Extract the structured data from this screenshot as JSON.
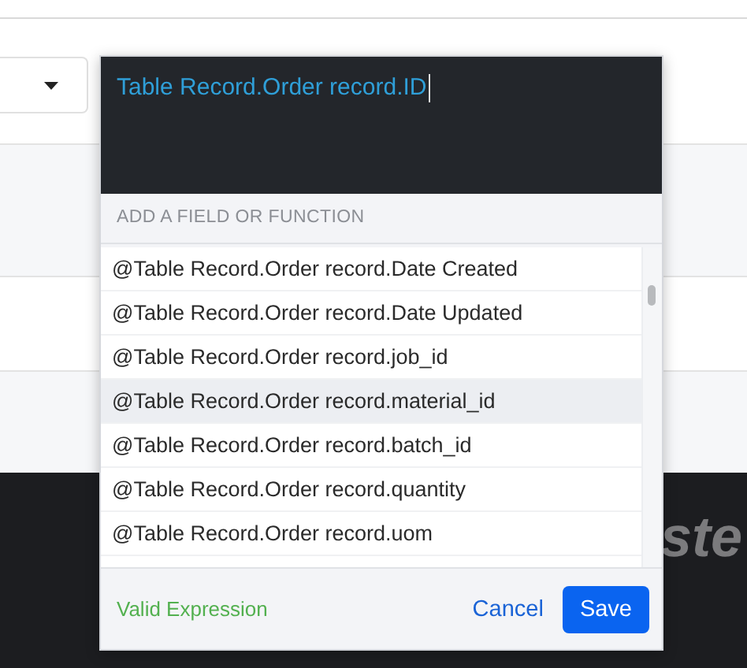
{
  "background": {
    "banner_texts": [
      {
        "text": "ste",
        "kind": "upper"
      }
    ]
  },
  "expression_editor": {
    "value": "Table Record.Order record.ID",
    "section_label": "ADD A FIELD OR FUNCTION",
    "suggestions": [
      {
        "label": "@Table Record.Order record.Date Created",
        "selected": false
      },
      {
        "label": "@Table Record.Order record.Date Updated",
        "selected": false
      },
      {
        "label": "@Table Record.Order record.job_id",
        "selected": false
      },
      {
        "label": "@Table Record.Order record.material_id",
        "selected": true
      },
      {
        "label": "@Table Record.Order record.batch_id",
        "selected": false
      },
      {
        "label": "@Table Record.Order record.quantity",
        "selected": false
      },
      {
        "label": "@Table Record.Order record.uom",
        "selected": false
      }
    ],
    "status": "Valid Expression",
    "buttons": [
      {
        "label": "Cancel",
        "kind": "link"
      },
      {
        "label": "Save",
        "kind": "primary"
      }
    ]
  }
}
